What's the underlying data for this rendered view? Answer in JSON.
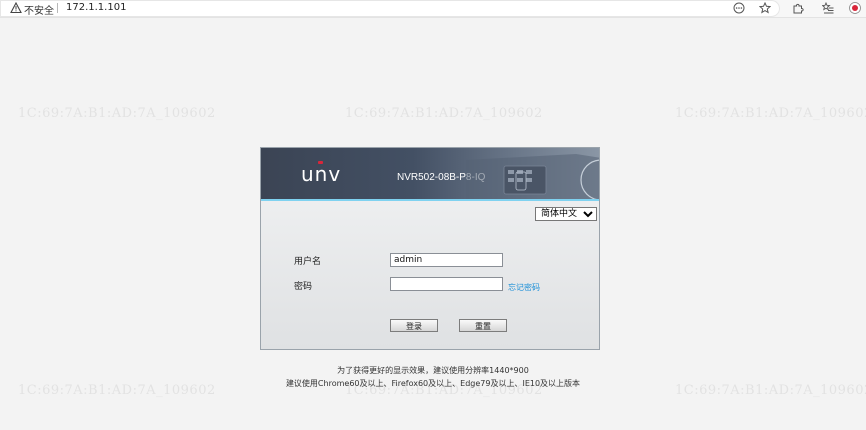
{
  "browser": {
    "not_secure_label": "不安全",
    "url": "172.1.1.101",
    "icons": [
      "warning-icon",
      "more-icon",
      "favorite-star-icon",
      "extensions-icon",
      "favorites-list-icon",
      "profile-icon"
    ]
  },
  "watermark": {
    "text": "1C:69:7A:B1:AD:7A_109602"
  },
  "login": {
    "brand": "unv",
    "model": "NVR502-08B-P8-IQ",
    "language": {
      "selected": "简体中文",
      "options": [
        "简体中文"
      ]
    },
    "username_label": "用户名",
    "username_value": "admin",
    "password_label": "密码",
    "password_value": "",
    "forgot_password": "忘记密码",
    "login_button": "登录",
    "reset_button": "重置"
  },
  "hints": {
    "line1": "为了获得更好的显示效果，建议使用分辨率1440*900",
    "line2": "建议使用Chrome60及以上、Firefox60及以上、Edge79及以上、IE10及以上版本"
  },
  "colors": {
    "accent_line": "#7fd2f0",
    "brand_dot": "#d9263a",
    "link": "#1a8fd8"
  }
}
